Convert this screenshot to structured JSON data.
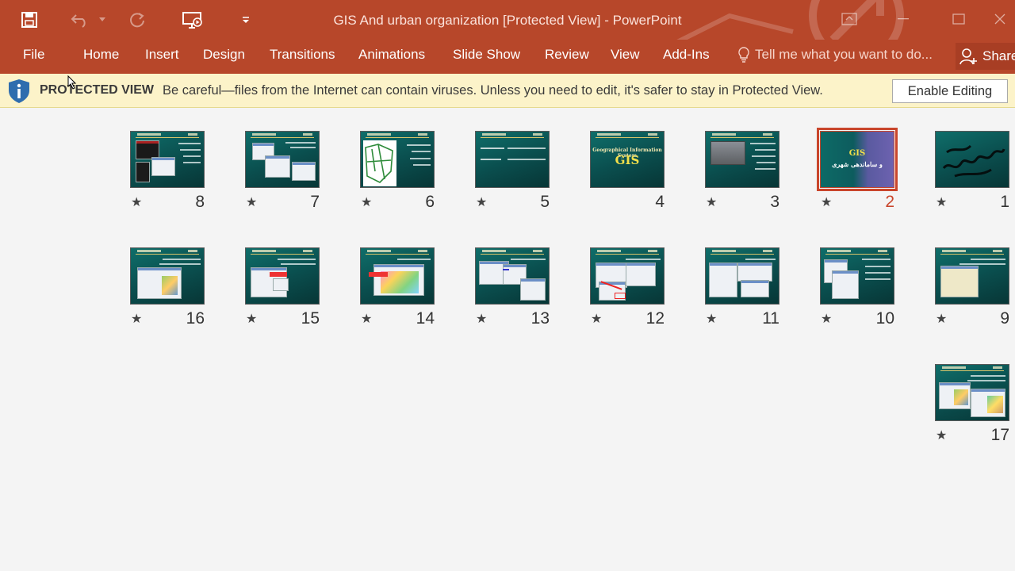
{
  "window": {
    "title": "GIS And urban organization [Protected View] - PowerPoint"
  },
  "ribbon": {
    "tabs": [
      "File",
      "Home",
      "Insert",
      "Design",
      "Transitions",
      "Animations",
      "Slide Show",
      "Review",
      "View",
      "Add-Ins"
    ],
    "tell_me": "Tell me what you want to do...",
    "share": "Share"
  },
  "protected_view": {
    "title": "PROTECTED VIEW",
    "message": "Be careful—files from the Internet can contain viruses. Unless you need to edit, it's safer to stay in Protected View.",
    "enable_button": "Enable Editing"
  },
  "slides": {
    "s1": {
      "number": "1"
    },
    "s2": {
      "number": "2",
      "title": "GIS",
      "subtitle": "و ساماندهی شهری"
    },
    "s3": {
      "number": "3"
    },
    "s4": {
      "number": "4",
      "title": "GIS",
      "subtitle": "Geographical Information System"
    },
    "s5": {
      "number": "5"
    },
    "s6": {
      "number": "6"
    },
    "s7": {
      "number": "7"
    },
    "s8": {
      "number": "8"
    },
    "s9": {
      "number": "9"
    },
    "s10": {
      "number": "10"
    },
    "s11": {
      "number": "11"
    },
    "s12": {
      "number": "12"
    },
    "s13": {
      "number": "13"
    },
    "s14": {
      "number": "14"
    },
    "s15": {
      "number": "15"
    },
    "s16": {
      "number": "16"
    },
    "s17": {
      "number": "17"
    }
  },
  "transition_marker": "★",
  "colors": {
    "accent": "#b7472a",
    "selected": "#c9452b",
    "slide_bg": "#0a4d4d",
    "pv_bar": "#fcf3c9"
  }
}
